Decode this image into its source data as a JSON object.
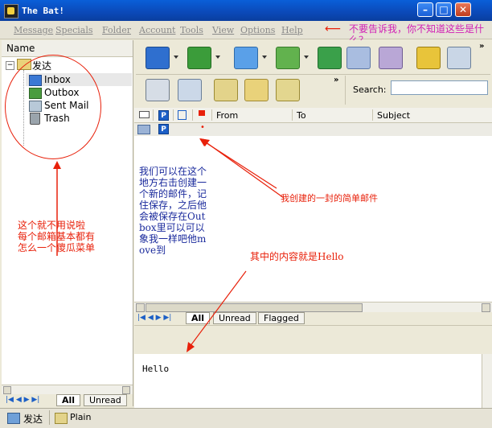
{
  "window": {
    "title": "The Bat!"
  },
  "menu": [
    "Message",
    "Specials",
    "Folder",
    "Account",
    "Tools",
    "View",
    "Options",
    "Help"
  ],
  "folders": {
    "header": "Name",
    "account": "发达",
    "items": [
      "Inbox",
      "Outbox",
      "Sent Mail",
      "Trash"
    ]
  },
  "search": {
    "label": "Search:",
    "value": ""
  },
  "message_list": {
    "columns": [
      "From",
      "To",
      "Subject"
    ],
    "row_marker": "•"
  },
  "list_tabs": [
    "All",
    "Unread",
    "Flagged"
  ],
  "folder_tabs": [
    "All",
    "Unread"
  ],
  "preview": {
    "body": "Hello"
  },
  "status": {
    "account": "发达",
    "mode": "Plain"
  },
  "annotations": {
    "top_note": "不要告诉我，你不知道这些是什么？",
    "folder_note": "这个就不用说啦\n每个邮箱基本都有\n怎么一个傻瓜菜单",
    "create_note": "我们可以在这个地方右击创建一个新的邮件，记住保存，之后他会被保存在Outbox里可以可以象我一样吧他move到",
    "email_note": "我创建的一封的简单邮件",
    "content_note": "其中的内容就是Hello"
  },
  "colors": {
    "titlebar": "#0b49b8",
    "annotation_red": "#e8200a",
    "annotation_blue": "#1a2a9c",
    "annotation_pink": "#d11fb5"
  }
}
